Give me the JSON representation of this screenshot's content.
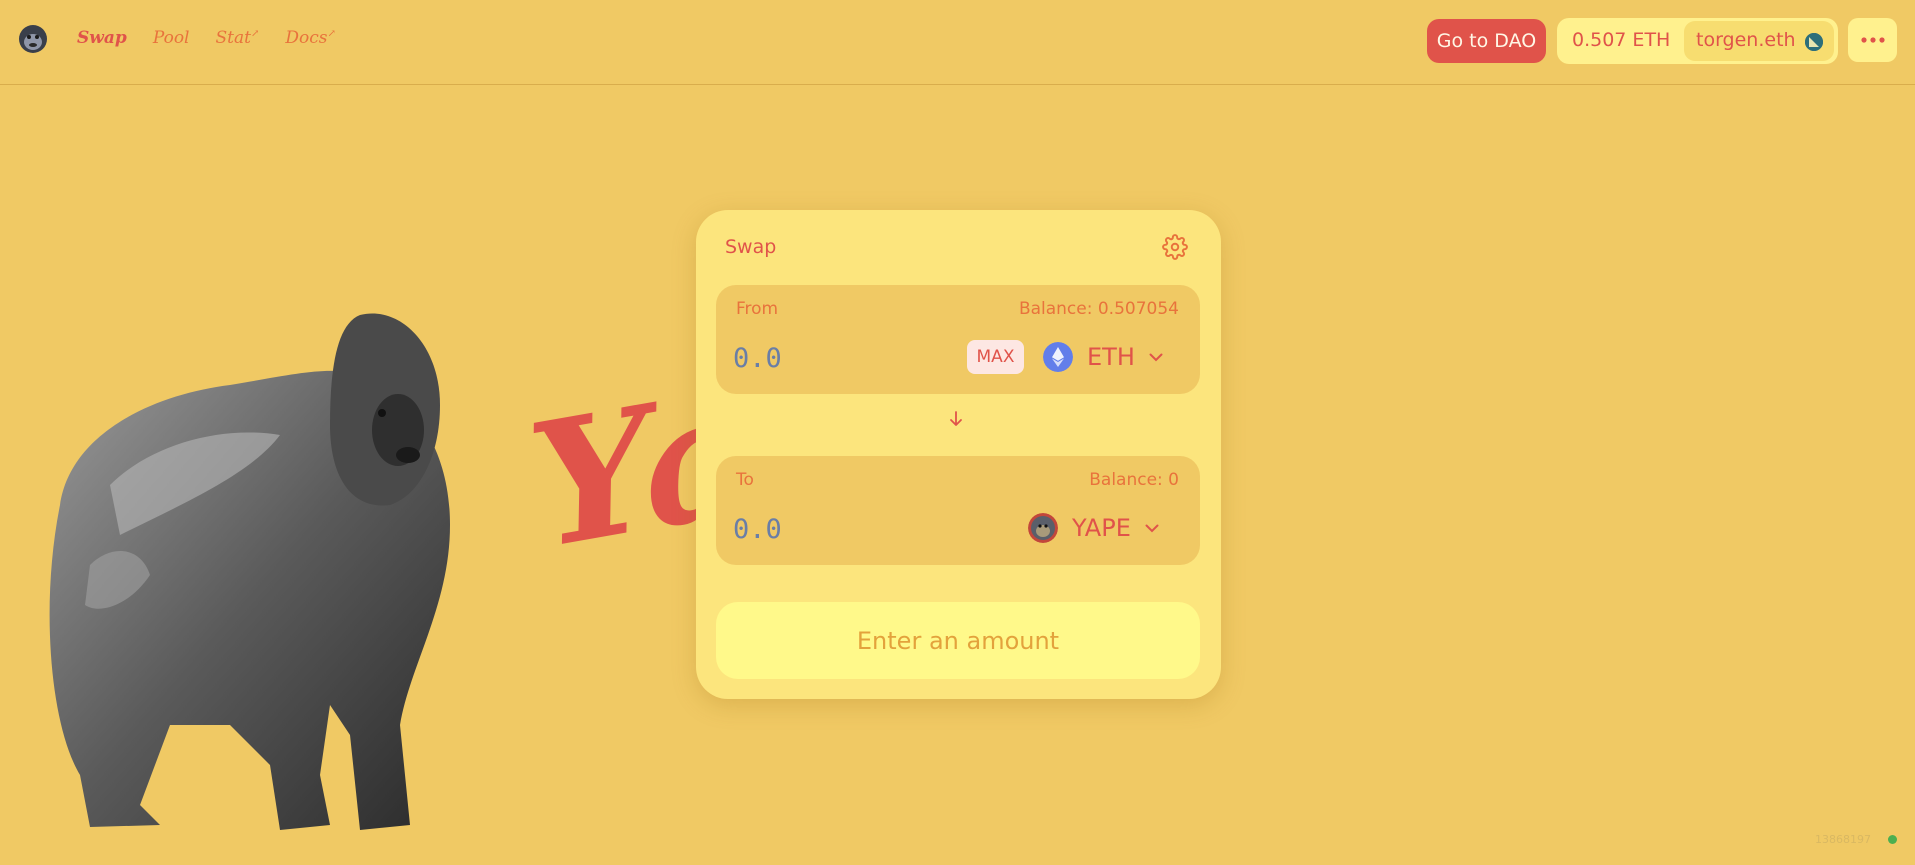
{
  "nav": {
    "items": [
      {
        "label": "Swap",
        "active": true
      },
      {
        "label": "Pool",
        "active": false
      },
      {
        "label": "Stat",
        "external": true
      },
      {
        "label": "Docs",
        "external": true
      }
    ],
    "external_mark": "↗"
  },
  "header": {
    "dao_button": "Go to DAO",
    "balance": "0.507 ETH",
    "ens": "torgen.eth",
    "more_icon": "more-dots-icon"
  },
  "background": {
    "big_text": "Ya"
  },
  "swap": {
    "title": "Swap",
    "from": {
      "label": "From",
      "balance": "Balance: 0.507054",
      "placeholder": "0.0",
      "max_label": "MAX",
      "token": "ETH"
    },
    "to": {
      "label": "To",
      "balance": "Balance: 0",
      "placeholder": "0.0",
      "token": "YAPE"
    },
    "action_label": "Enter an amount"
  },
  "footer": {
    "block_number": "13868197"
  },
  "colors": {
    "background": "#f0c964",
    "accent": "#e0534a",
    "card": "#fce57d",
    "button_light": "#fff98a",
    "status_dot": "#4caf50"
  }
}
